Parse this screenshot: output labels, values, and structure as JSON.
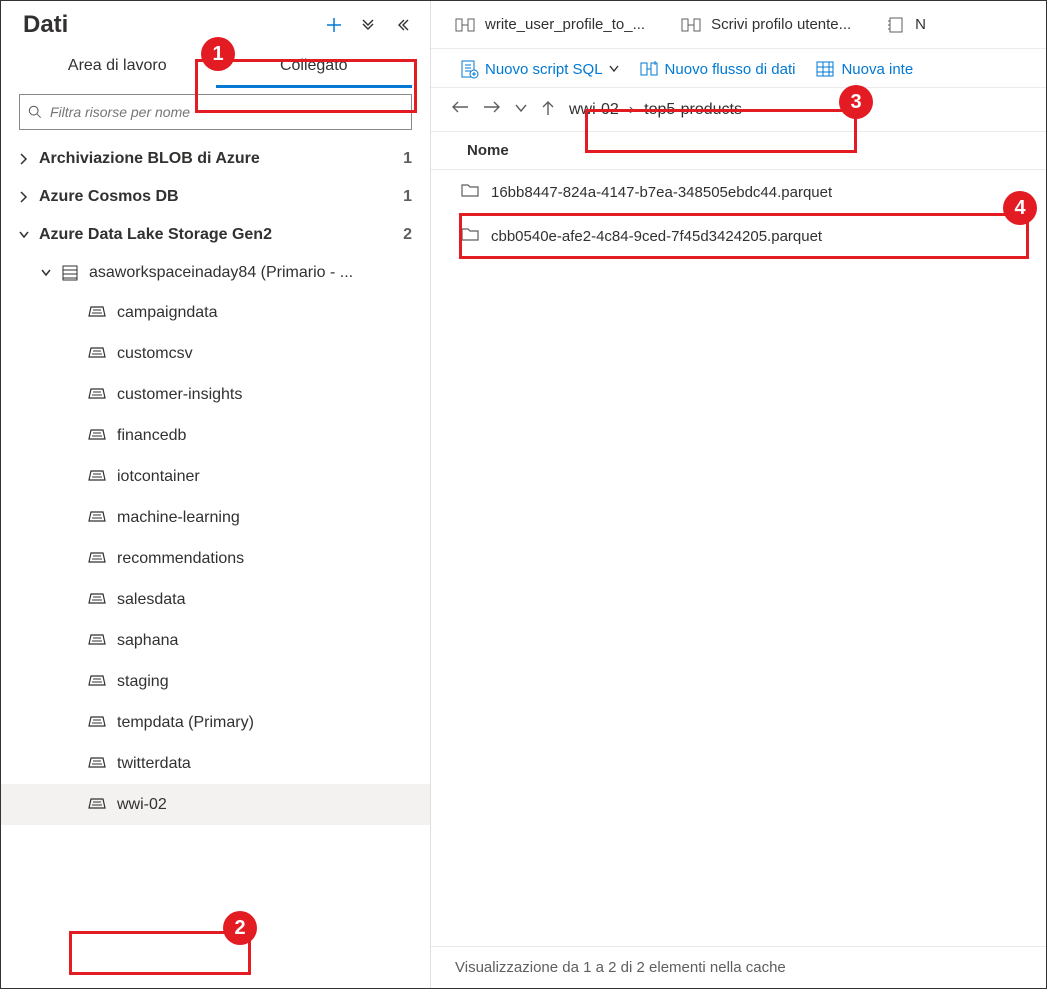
{
  "sidebar": {
    "title": "Dati",
    "tabs": {
      "workspace": "Area di lavoro",
      "linked": "Collegato"
    },
    "filter_placeholder": "Filtra risorse per nome",
    "tree": {
      "blob": {
        "label": "Archiviazione BLOB di Azure",
        "count": "1"
      },
      "cosmos": {
        "label": "Azure Cosmos DB",
        "count": "1"
      },
      "adls": {
        "label": "Azure Data Lake Storage Gen2",
        "count": "2"
      },
      "workspace_item": "asaworkspaceinaday84 (Primario - ...",
      "containers": [
        "campaigndata",
        "customcsv",
        "customer-insights",
        "financedb",
        "iotcontainer",
        "machine-learning",
        "recommendations",
        "salesdata",
        "saphana",
        "staging",
        "tempdata (Primary)",
        "twitterdata",
        "wwi-02"
      ]
    }
  },
  "main": {
    "doc_tabs": [
      {
        "label": "write_user_profile_to_..."
      },
      {
        "label": "Scrivi profilo utente..."
      },
      {
        "label": "N"
      }
    ],
    "toolbar": {
      "new_sql": "Nuovo script SQL",
      "new_flow": "Nuovo flusso di dati",
      "new_int": "Nuova inte"
    },
    "breadcrumb": {
      "root": "wwi-02",
      "folder": "top5-products"
    },
    "list_header": "Nome",
    "files": [
      "16bb8447-824a-4147-b7ea-348505ebdc44.parquet",
      "cbb0540e-afe2-4c84-9ced-7f45d3424205.parquet"
    ],
    "status": "Visualizzazione da 1 a 2 di 2 elementi nella cache"
  },
  "callouts": [
    "1",
    "2",
    "3",
    "4"
  ]
}
